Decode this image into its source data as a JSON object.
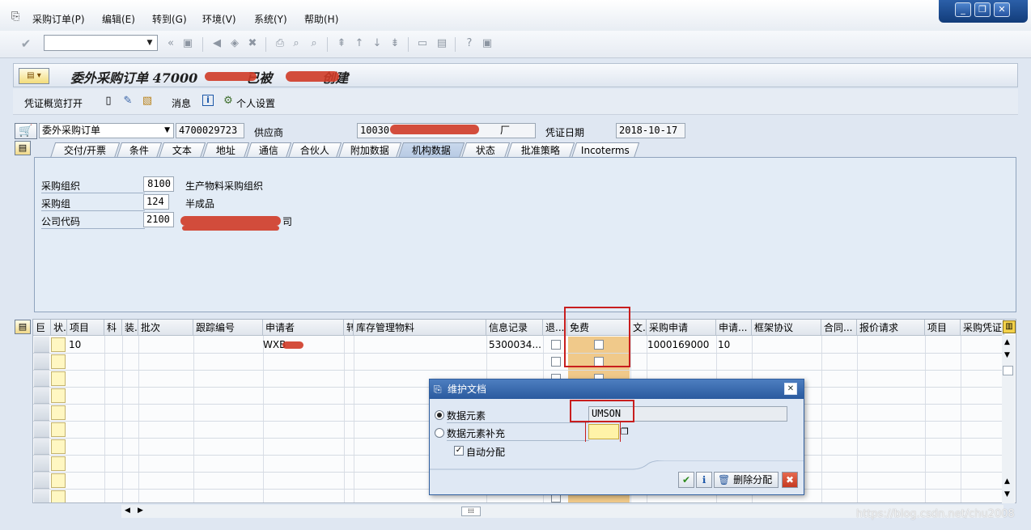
{
  "menu": {
    "items": [
      "采购订单(P)",
      "编辑(E)",
      "转到(G)",
      "环境(V)",
      "系统(Y)",
      "帮助(H)"
    ]
  },
  "window_controls": {
    "minimize": "_",
    "restore": "❐",
    "close": "✕"
  },
  "title": {
    "prefix": "委外采购订单 47000",
    "middle": "已被",
    "suffix": "创建"
  },
  "app_toolbar": {
    "overview": "凭证概览打开",
    "messages": "消息",
    "personal": "个人设置"
  },
  "header": {
    "doc_type": "委外采购订单",
    "po_number": "4700029723",
    "vendor_label": "供应商",
    "vendor_value": "10030",
    "vendor_tail": "厂",
    "date_label": "凭证日期",
    "date_value": "2018-10-17"
  },
  "tabs": [
    "交付/开票",
    "条件",
    "文本",
    "地址",
    "通信",
    "合伙人",
    "附加数据",
    "机构数据",
    "状态",
    "批准策略",
    "Incoterms"
  ],
  "org_data": {
    "purch_org_label": "采购组织",
    "purch_org_code": "8100",
    "purch_org_desc": "生产物料采购组织",
    "purch_group_label": "采购组",
    "purch_group_code": "124",
    "purch_group_desc": "半成品",
    "company_label": "公司代码",
    "company_code": "2100",
    "company_desc": "司"
  },
  "grid": {
    "columns": [
      "巨",
      "状.",
      "项目",
      "科",
      "装.",
      "批次",
      "跟踪编号",
      "申请者",
      "转",
      "库存管理物料",
      "信息记录",
      "退...",
      "免费",
      "文.",
      "采购申请",
      "申请...",
      "框架协议",
      "合同...",
      "报价请求",
      "项目",
      "采购凭证"
    ],
    "row1": {
      "item": "10",
      "requester": "WXB",
      "info_record": "5300034...",
      "pr": "1000169000",
      "pr_item": "10"
    }
  },
  "dialog": {
    "title": "维护文档",
    "opt1": "数据元素",
    "value1": "UMSON",
    "opt2": "数据元素补充",
    "auto": "自动分配",
    "delete": "删除分配"
  },
  "watermark": "https://blog.csdn.net/chu2008"
}
